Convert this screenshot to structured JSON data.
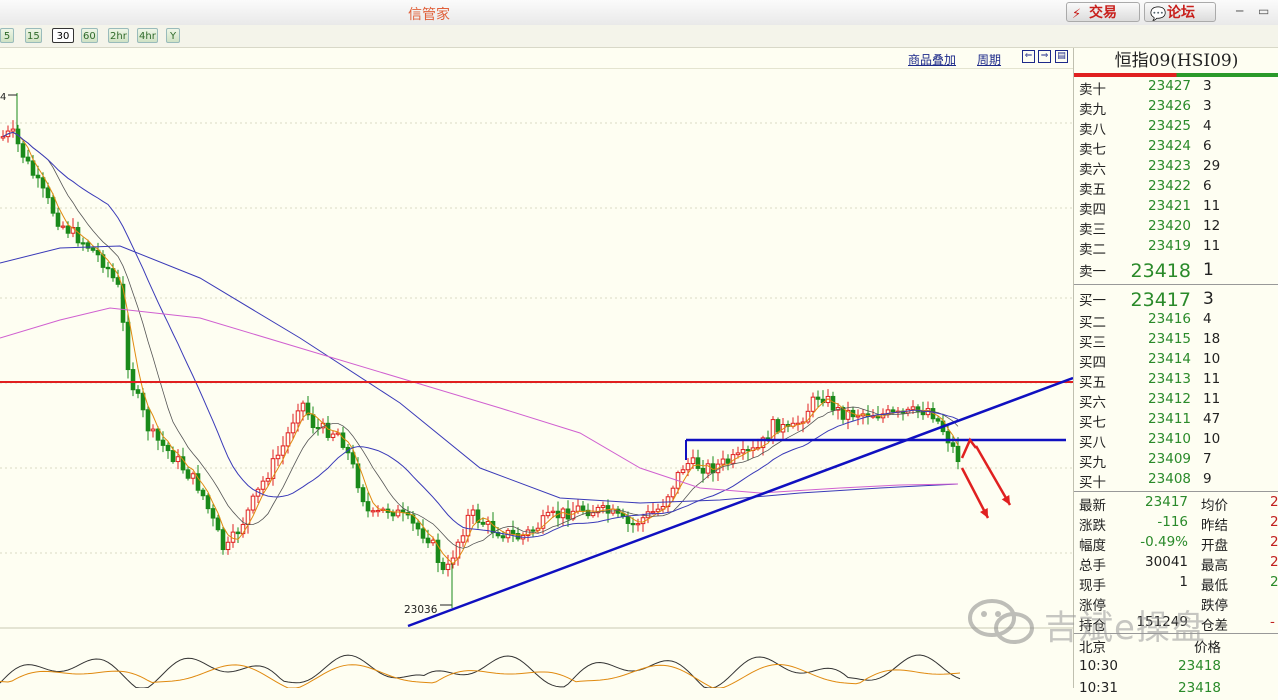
{
  "window": {
    "title": "信管家",
    "trade_button": "交易",
    "forum_button": "论坛"
  },
  "periods": [
    "5",
    "15",
    "30",
    "60",
    "2hr",
    "4hr",
    "Y"
  ],
  "active_period": "30",
  "chart": {
    "menu_overlay": "商品叠加",
    "menu_period": "周期",
    "high_label": "4",
    "low_label": "23036"
  },
  "colors": {
    "up": "#e02020",
    "down": "#1a8a1a",
    "ma_short": "#e08a10",
    "ma_mid": "#3a3ab8",
    "ma_long": "#d060d0",
    "trendline": "#1010c0",
    "resistance": "#e02020"
  },
  "quote": {
    "symbol": "恒指09(HSI09)",
    "asks": [
      {
        "label": "卖十",
        "price": "23427",
        "vol": "3"
      },
      {
        "label": "卖九",
        "price": "23426",
        "vol": "3"
      },
      {
        "label": "卖八",
        "price": "23425",
        "vol": "4"
      },
      {
        "label": "卖七",
        "price": "23424",
        "vol": "6"
      },
      {
        "label": "卖六",
        "price": "23423",
        "vol": "29"
      },
      {
        "label": "卖五",
        "price": "23422",
        "vol": "6"
      },
      {
        "label": "卖四",
        "price": "23421",
        "vol": "11"
      },
      {
        "label": "卖三",
        "price": "23420",
        "vol": "12"
      },
      {
        "label": "卖二",
        "price": "23419",
        "vol": "11"
      },
      {
        "label": "卖一",
        "price": "23418",
        "vol": "1"
      }
    ],
    "bids": [
      {
        "label": "买一",
        "price": "23417",
        "vol": "3"
      },
      {
        "label": "买二",
        "price": "23416",
        "vol": "4"
      },
      {
        "label": "买三",
        "price": "23415",
        "vol": "18"
      },
      {
        "label": "买四",
        "price": "23414",
        "vol": "10"
      },
      {
        "label": "买五",
        "price": "23413",
        "vol": "11"
      },
      {
        "label": "买六",
        "price": "23412",
        "vol": "11"
      },
      {
        "label": "买七",
        "price": "23411",
        "vol": "47"
      },
      {
        "label": "买八",
        "price": "23410",
        "vol": "10"
      },
      {
        "label": "买九",
        "price": "23409",
        "vol": "7"
      },
      {
        "label": "买十",
        "price": "23408",
        "vol": "9"
      }
    ],
    "stats": [
      {
        "l": "最新",
        "v": "23417",
        "l2": "均价",
        "v2": "2"
      },
      {
        "l": "涨跌",
        "v": "-116",
        "l2": "昨结",
        "v2": "2"
      },
      {
        "l": "幅度",
        "v": "-0.49%",
        "l2": "开盘",
        "v2": "2"
      },
      {
        "l": "总手",
        "v": "30041",
        "l2": "最高",
        "v2": "2"
      },
      {
        "l": "现手",
        "v": "1",
        "l2": "最低",
        "v2": "2"
      },
      {
        "l": "涨停",
        "v": "",
        "l2": "跌停",
        "v2": ""
      },
      {
        "l": "持仓",
        "v": "151249",
        "l2": "仓差",
        "v2": "-"
      }
    ],
    "tick_header": {
      "place": "北京",
      "price": "价格"
    },
    "ticks": [
      {
        "time": "10:30",
        "price": "23418"
      },
      {
        "time": "10:31",
        "price": "23418"
      }
    ]
  },
  "watermark": "吉斌e操盘"
}
